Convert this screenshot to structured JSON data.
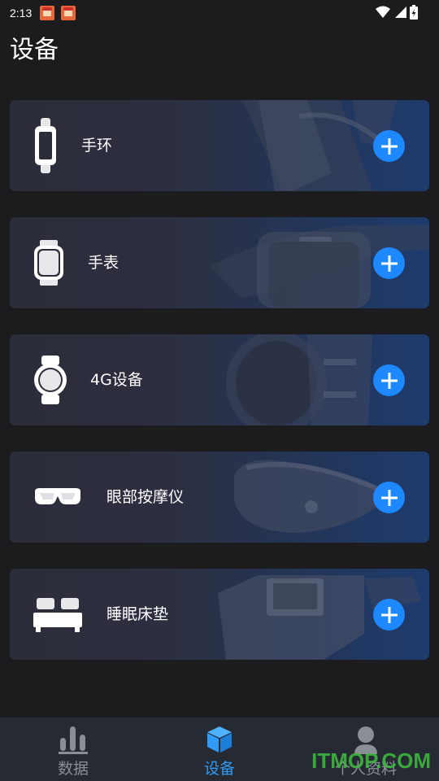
{
  "status_bar": {
    "time": "2:13",
    "icons": [
      "notification-app-icon",
      "notification-app-icon",
      "wifi-icon",
      "signal-icon",
      "battery-charging-icon"
    ]
  },
  "header": {
    "title": "设备"
  },
  "devices": [
    {
      "label": "手环",
      "icon": "band-icon"
    },
    {
      "label": "手表",
      "icon": "watch-icon"
    },
    {
      "label": "4G设备",
      "icon": "round-watch-icon"
    },
    {
      "label": "眼部按摩仪",
      "icon": "eye-massager-icon"
    },
    {
      "label": "睡眠床垫",
      "icon": "bed-icon"
    }
  ],
  "bottom_nav": {
    "items": [
      {
        "label": "数据",
        "icon": "bar-chart-icon",
        "active": false
      },
      {
        "label": "设备",
        "icon": "cube-icon",
        "active": true
      },
      {
        "label": "个人资料",
        "icon": "person-icon",
        "active": false
      }
    ]
  },
  "watermark": "ITMOP.COM",
  "colors": {
    "background": "#1c1c1e",
    "accent": "#1e88ff",
    "nav_active": "#2f9bf5",
    "nav_inactive": "#8b8e96",
    "nav_background": "#262a33"
  }
}
